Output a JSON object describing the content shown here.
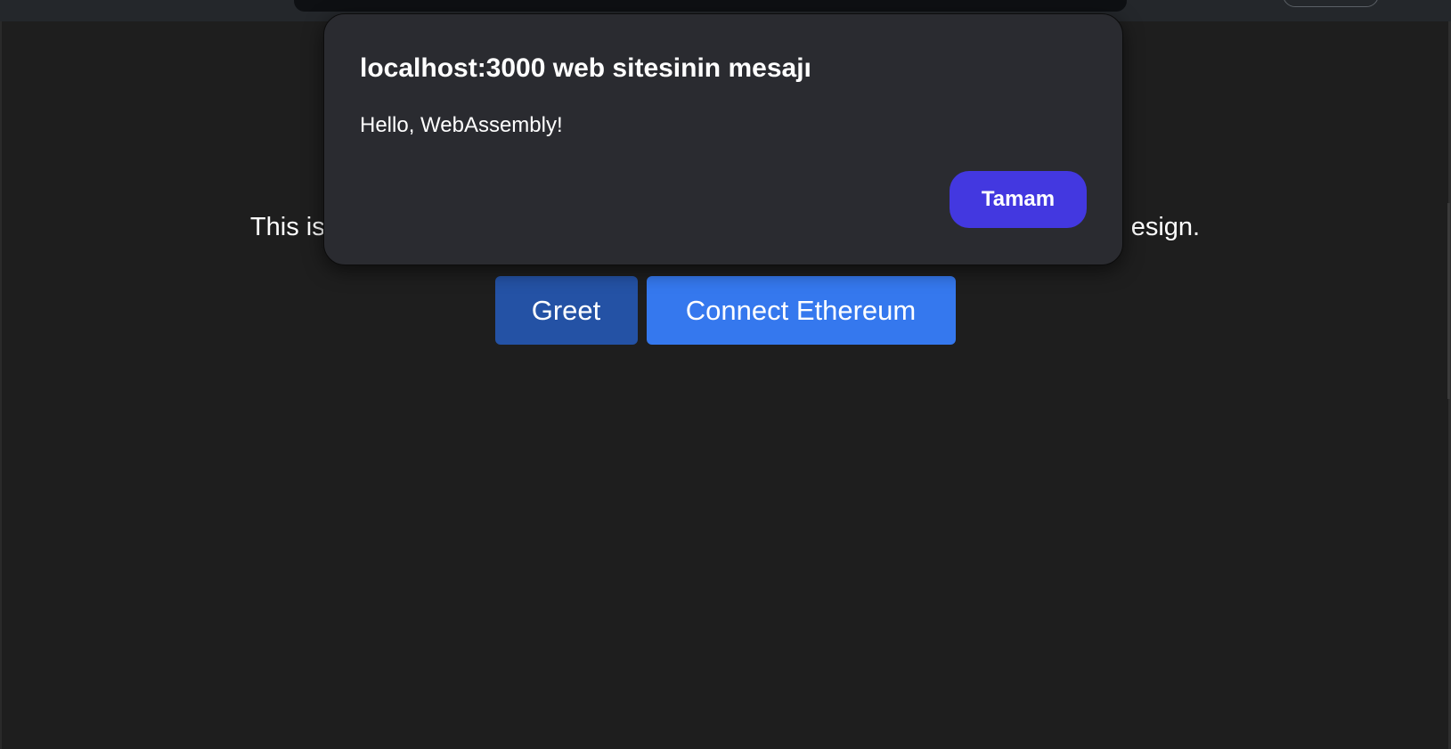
{
  "page": {
    "description_visible": "This is",
    "description_hidden": "",
    "description_tail": "esign.",
    "greet_label": "Greet",
    "connect_label": "Connect Ethereum"
  },
  "dialog": {
    "title": "localhost:3000 web sitesinin mesajı",
    "message": "Hello, WebAssembly!",
    "ok_label": "Tamam"
  },
  "colors": {
    "background": "#1e1e1e",
    "dialog_background": "#2a2b30",
    "greet_button": "#2452a5",
    "connect_button": "#3578ee",
    "dialog_ok_button": "#4338e0"
  }
}
